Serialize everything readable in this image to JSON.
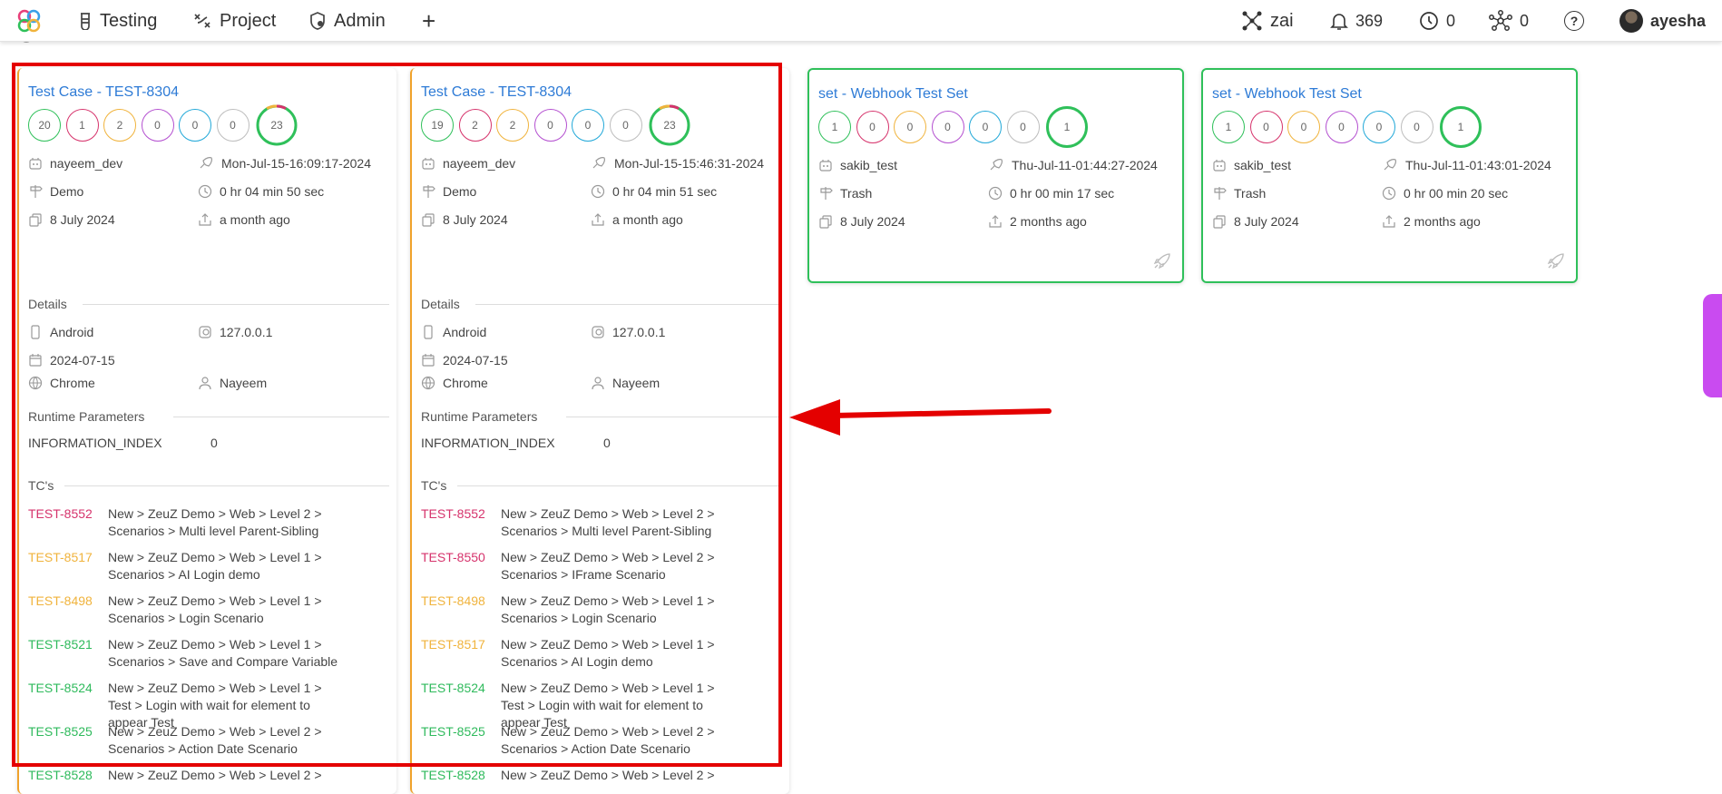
{
  "nav": {
    "testing": "Testing",
    "project": "Project",
    "admin": "Admin",
    "add": "+",
    "zai": "zai",
    "notifications": "369",
    "clock_count": "0",
    "network_count": "0",
    "help": "?",
    "user": "ayesha"
  },
  "cards": [
    {
      "title": "Test Case - TEST-8304",
      "circles": [
        "20",
        "1",
        "2",
        "0",
        "0",
        "0",
        "23"
      ],
      "user": "nayeem_dev",
      "datetime": "Mon-Jul-15-16:09:17-2024",
      "project": "Demo",
      "duration": "0 hr 04 min 50 sec",
      "date": "8 July 2024",
      "ago": "a month ago",
      "details_label": "Details",
      "os": "Android",
      "ip": "127.0.0.1",
      "run_date": "2024-07-15",
      "browser": "Chrome",
      "tester": "Nayeem",
      "runtime_label": "Runtime Parameters",
      "param_name": "INFORMATION_INDEX",
      "param_value": "0",
      "tcs_label": "TC's",
      "tcs": [
        {
          "id": "TEST-8552",
          "color": "#d6336c",
          "path": "New > ZeuZ Demo > Web > Level 2 > Scenarios > Multi level Parent-Sibling"
        },
        {
          "id": "TEST-8517",
          "color": "#f0b33c",
          "path": "New > ZeuZ Demo > Web > Level 1 > Scenarios > AI Login demo"
        },
        {
          "id": "TEST-8498",
          "color": "#f0b33c",
          "path": "New > ZeuZ Demo > Web > Level 1 > Scenarios > Login Scenario"
        },
        {
          "id": "TEST-8521",
          "color": "#2fba5c",
          "path": "New > ZeuZ Demo > Web > Level 1 > Scenarios > Save and Compare Variable"
        },
        {
          "id": "TEST-8524",
          "color": "#2fba5c",
          "path": "New > ZeuZ Demo > Web > Level 1 > Test > Login with wait for element to appear Test"
        },
        {
          "id": "TEST-8525",
          "color": "#2fba5c",
          "path": "New > ZeuZ Demo > Web > Level 2 > Scenarios > Action Date Scenario"
        },
        {
          "id": "TEST-8528",
          "color": "#2fba5c",
          "path": "New > ZeuZ Demo > Web > Level 2 >"
        }
      ]
    },
    {
      "title": "Test Case - TEST-8304",
      "circles": [
        "19",
        "2",
        "2",
        "0",
        "0",
        "0",
        "23"
      ],
      "user": "nayeem_dev",
      "datetime": "Mon-Jul-15-15:46:31-2024",
      "project": "Demo",
      "duration": "0 hr 04 min 51 sec",
      "date": "8 July 2024",
      "ago": "a month ago",
      "details_label": "Details",
      "os": "Android",
      "ip": "127.0.0.1",
      "run_date": "2024-07-15",
      "browser": "Chrome",
      "tester": "Nayeem",
      "runtime_label": "Runtime Parameters",
      "param_name": "INFORMATION_INDEX",
      "param_value": "0",
      "tcs_label": "TC's",
      "tcs": [
        {
          "id": "TEST-8552",
          "color": "#d6336c",
          "path": "New > ZeuZ Demo > Web > Level 2 > Scenarios > Multi level Parent-Sibling"
        },
        {
          "id": "TEST-8550",
          "color": "#d6336c",
          "path": "New > ZeuZ Demo > Web > Level 2 > Scenarios > IFrame Scenario"
        },
        {
          "id": "TEST-8498",
          "color": "#f0b33c",
          "path": "New > ZeuZ Demo > Web > Level 1 > Scenarios > Login Scenario"
        },
        {
          "id": "TEST-8517",
          "color": "#f0b33c",
          "path": "New > ZeuZ Demo > Web > Level 1 > Scenarios > AI Login demo"
        },
        {
          "id": "TEST-8524",
          "color": "#2fba5c",
          "path": "New > ZeuZ Demo > Web > Level 1 > Test > Login with wait for element to appear Test"
        },
        {
          "id": "TEST-8525",
          "color": "#2fba5c",
          "path": "New > ZeuZ Demo > Web > Level 2 > Scenarios > Action Date Scenario"
        },
        {
          "id": "TEST-8528",
          "color": "#2fba5c",
          "path": "New > ZeuZ Demo > Web > Level 2 >"
        }
      ]
    },
    {
      "title": "set - Webhook Test Set",
      "circles": [
        "1",
        "0",
        "0",
        "0",
        "0",
        "0",
        "1"
      ],
      "user": "sakib_test",
      "datetime": "Thu-Jul-11-01:44:27-2024",
      "project": "Trash",
      "duration": "0 hr 00 min 17 sec",
      "date": "8 July 2024",
      "ago": "2 months ago"
    },
    {
      "title": "set - Webhook Test Set",
      "circles": [
        "1",
        "0",
        "0",
        "0",
        "0",
        "0",
        "1"
      ],
      "user": "sakib_test",
      "datetime": "Thu-Jul-11-01:43:01-2024",
      "project": "Trash",
      "duration": "0 hr 00 min 20 sec",
      "date": "8 July 2024",
      "ago": "2 months ago"
    }
  ],
  "colors": {
    "passed": "#2fc05a",
    "failed": "#d6336c",
    "blocked": "#f0b33c",
    "skipped": "#b450d0",
    "running": "#21a8d8",
    "notrun": "#bdbdbd",
    "link": "#2e7bd6",
    "highlight": "#e40000"
  }
}
